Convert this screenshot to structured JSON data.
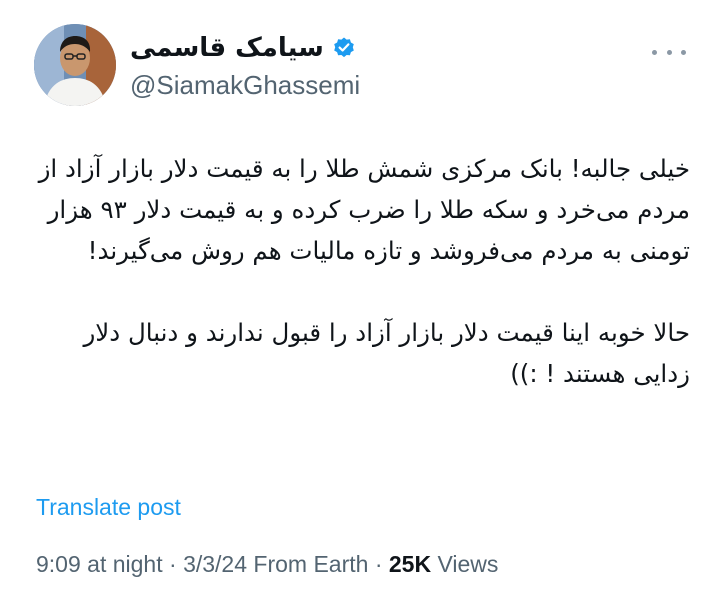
{
  "author": {
    "display_name": "سیامک قاسمی",
    "handle": "@SiamakGhassemi",
    "verified": true,
    "verified_badge_color": "#1d9bf0"
  },
  "menu": {
    "icon": "more-horizontal-icon"
  },
  "tweet": {
    "paragraphs": [
      "خیلی جالبه! بانک مرکزی شمش طلا را به قیمت دلار بازار آزاد از مردم می‌خرد و سکه طلا را ضرب کرده و به قیمت دلار ۹۳ هزار تومنی به مردم می‌فروشد و تازه مالیات هم روش می‌گیرند!",
      "حالا خوبه اینا قیمت دلار بازار آزاد را قبول ندارند و دنبال دلار زدایی هستند ! :))"
    ]
  },
  "translate_label": "Translate post",
  "meta": {
    "time": "9:09 at night",
    "sep1": " · ",
    "date": "3/3/24",
    "source": " From Earth",
    "sep2": " · ",
    "views_count": "25K",
    "views_label": " Views"
  },
  "colors": {
    "link": "#1d9bf0",
    "muted": "#536471",
    "text": "#0f1419"
  }
}
